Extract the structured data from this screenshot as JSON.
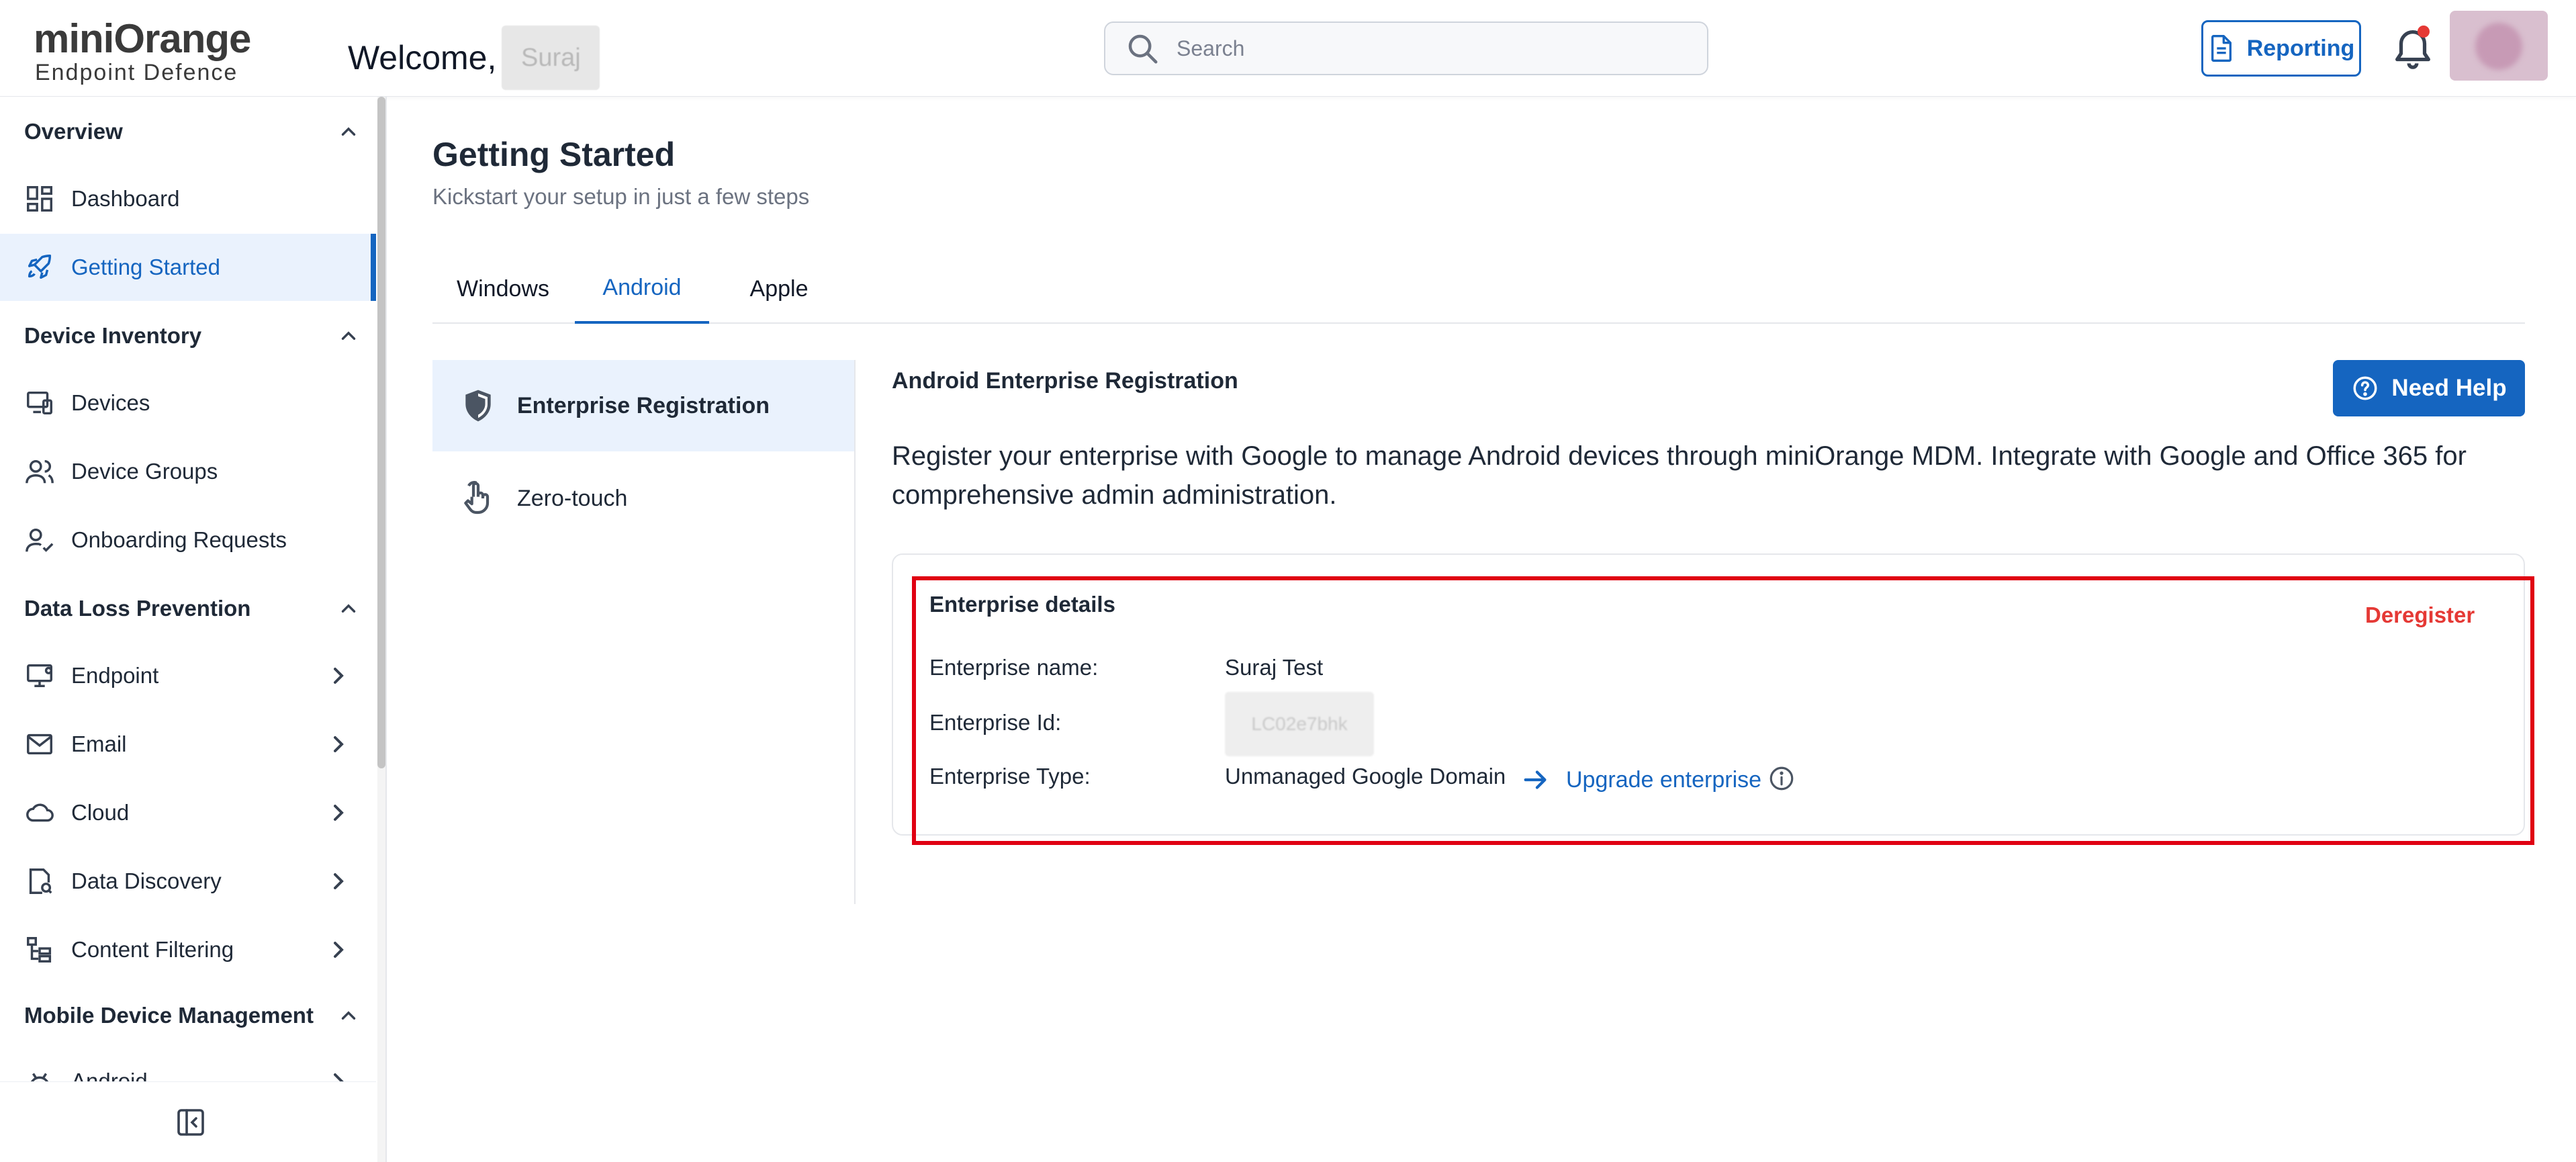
{
  "header": {
    "logo_text": "miniOrange",
    "logo_subtext": "Endpoint Defence",
    "welcome_label": "Welcome,",
    "welcome_name": "Suraj",
    "search_placeholder": "Search",
    "reporting_label": "Reporting",
    "notification_dot_color": "#e53935"
  },
  "sidebar": {
    "sections": [
      {
        "label": "Overview",
        "expanded": true
      },
      {
        "label": "Device Inventory",
        "expanded": true
      },
      {
        "label": "Data Loss Prevention",
        "expanded": true
      },
      {
        "label": "Mobile Device Management",
        "expanded": true
      }
    ],
    "items": [
      {
        "label": "Dashboard",
        "icon": "dashboard-icon"
      },
      {
        "label": "Getting Started",
        "icon": "rocket-icon",
        "active": true
      },
      {
        "label": "Devices",
        "icon": "devices-icon"
      },
      {
        "label": "Device Groups",
        "icon": "users-icon"
      },
      {
        "label": "Onboarding Requests",
        "icon": "user-check-icon"
      },
      {
        "label": "Endpoint",
        "icon": "monitor-icon",
        "expandable": true
      },
      {
        "label": "Email",
        "icon": "mail-icon",
        "expandable": true
      },
      {
        "label": "Cloud",
        "icon": "cloud-icon",
        "expandable": true
      },
      {
        "label": "Data Discovery",
        "icon": "search-file-icon",
        "expandable": true
      },
      {
        "label": "Content Filtering",
        "icon": "filter-tree-icon",
        "expandable": true
      },
      {
        "label": "Android",
        "icon": "android-icon",
        "expandable": true
      }
    ],
    "accent_color": "#1565c0"
  },
  "main": {
    "title": "Getting Started",
    "subtitle": "Kickstart your setup in just a few steps",
    "tabs": [
      {
        "label": "Windows"
      },
      {
        "label": "Android",
        "active": true
      },
      {
        "label": "Apple"
      }
    ],
    "steps": [
      {
        "label": "Enterprise Registration",
        "icon": "shield-icon",
        "active": true
      },
      {
        "label": "Zero-touch",
        "icon": "touch-icon"
      }
    ],
    "section_title": "Android Enterprise Registration",
    "help_label": "Need Help",
    "description": "Register your enterprise with Google to manage Android devices through miniOrange MDM. Integrate with Google and Office 365 for comprehensive admin administration.",
    "enterprise": {
      "title": "Enterprise details",
      "deregister_label": "Deregister",
      "name_label": "Enterprise name:",
      "name_value": "Suraj Test",
      "id_label": "Enterprise Id:",
      "id_value": "LC02e7bhk",
      "type_label": "Enterprise Type:",
      "type_value": "Unmanaged Google Domain",
      "upgrade_label": "Upgrade enterprise"
    },
    "highlight_color": "#e00012"
  }
}
